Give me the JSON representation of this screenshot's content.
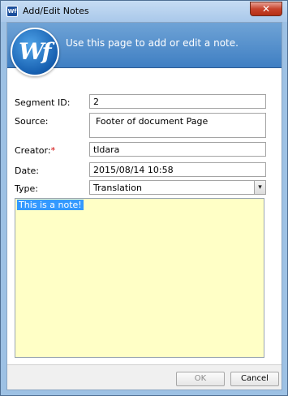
{
  "window": {
    "title": "Add/Edit Notes",
    "app_icon_text": "Wf",
    "close_symbol": "✕"
  },
  "header": {
    "logo_text": "Wf",
    "instruction": "Use this page to add or edit a note."
  },
  "form": {
    "segment_id": {
      "label": "Segment ID:",
      "value": "2"
    },
    "source": {
      "label": "Source:",
      "value": "Footer of document Page"
    },
    "creator": {
      "label": "Creator:",
      "required_marker": "*",
      "value": "tldara"
    },
    "date": {
      "label": "Date:",
      "value": "2015/08/14 10:58"
    },
    "type": {
      "label": "Type:",
      "value": "Translation",
      "arrow": "▾"
    }
  },
  "note": {
    "text": "This is a note!",
    "background_color": "#ffffc6"
  },
  "buttons": {
    "ok": "OK",
    "cancel": "Cancel"
  }
}
